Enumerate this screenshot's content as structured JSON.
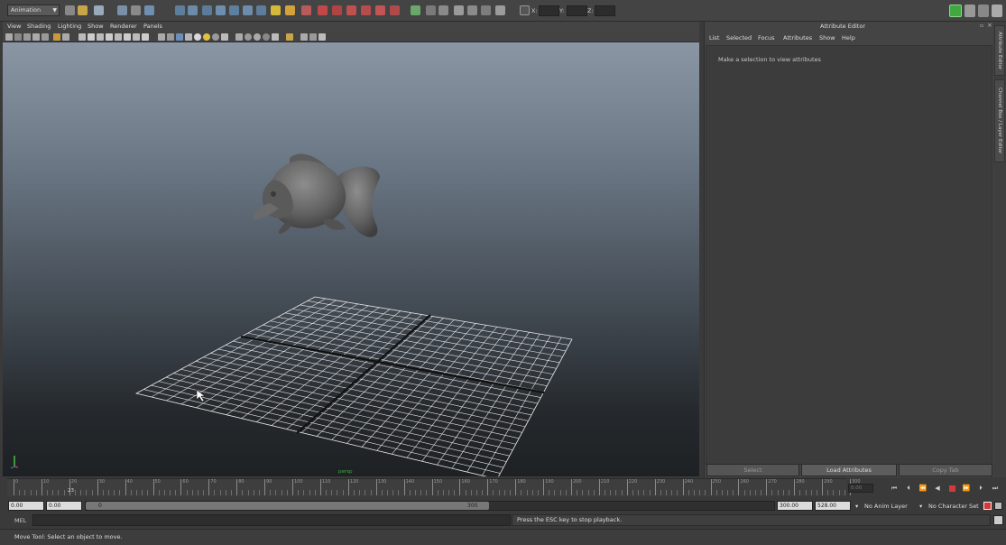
{
  "status_line": {
    "mode": "Animation",
    "x_label": "X:",
    "y_label": "Y:",
    "z_label": "Z:"
  },
  "viewport_panel": {
    "menus": [
      "View",
      "Shading",
      "Lighting",
      "Show",
      "Renderer",
      "Panels"
    ],
    "camera_label": "persp"
  },
  "attribute_editor": {
    "title": "Attribute Editor",
    "menus": [
      "List",
      "Selected",
      "Focus",
      "Attributes",
      "Show",
      "Help"
    ],
    "message": "Make a selection to view attributes",
    "buttons": {
      "select": "Select",
      "load": "Load Attributes",
      "copy": "Copy Tab"
    }
  },
  "side_tabs": {
    "attribute_editor": "Attribute Editor",
    "channel_box": "Channel Box / Layer Editor"
  },
  "time_slider": {
    "ticks": [
      "0",
      "10",
      "20",
      "30",
      "40",
      "50",
      "60",
      "70",
      "80",
      "90",
      "100",
      "110",
      "120",
      "130",
      "140",
      "150",
      "160",
      "170",
      "180",
      "190",
      "200",
      "210",
      "220",
      "230",
      "240",
      "250",
      "260",
      "270",
      "280",
      "290",
      "300"
    ],
    "current_frame": "23",
    "current_field": "0.00"
  },
  "range_slider": {
    "start_time": "0.00",
    "playback_start": "0.00",
    "range_start": "0",
    "range_end": "300",
    "playback_end": "300.00",
    "end_time": "528.00",
    "anim_layer": "No Anim Layer",
    "character_set": "No Character Set"
  },
  "command_line": {
    "label": "MEL",
    "result": "Press the ESC key to stop playback."
  },
  "help_line": {
    "text": "Move Tool: Select an object to move."
  },
  "colors": {
    "accent_green": "#3fa83f",
    "stop_red": "#d23a3a",
    "grid_line": "#e6e6e6"
  }
}
